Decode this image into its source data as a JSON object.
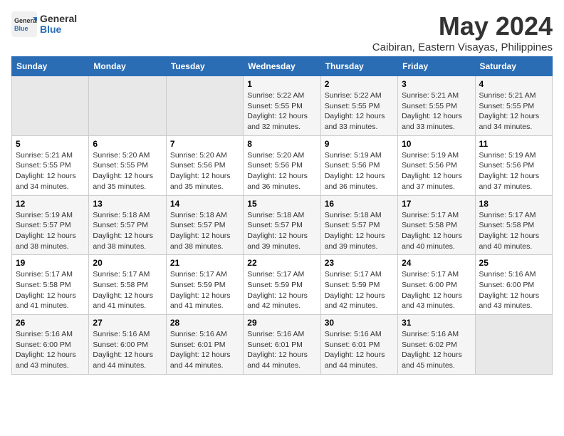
{
  "header": {
    "logo_general": "General",
    "logo_blue": "Blue",
    "month_year": "May 2024",
    "location": "Caibiran, Eastern Visayas, Philippines"
  },
  "weekdays": [
    "Sunday",
    "Monday",
    "Tuesday",
    "Wednesday",
    "Thursday",
    "Friday",
    "Saturday"
  ],
  "weeks": [
    [
      {
        "day": "",
        "sunrise": "",
        "sunset": "",
        "daylight": "",
        "empty": true
      },
      {
        "day": "",
        "sunrise": "",
        "sunset": "",
        "daylight": "",
        "empty": true
      },
      {
        "day": "",
        "sunrise": "",
        "sunset": "",
        "daylight": "",
        "empty": true
      },
      {
        "day": "1",
        "sunrise": "Sunrise: 5:22 AM",
        "sunset": "Sunset: 5:55 PM",
        "daylight": "Daylight: 12 hours and 32 minutes."
      },
      {
        "day": "2",
        "sunrise": "Sunrise: 5:22 AM",
        "sunset": "Sunset: 5:55 PM",
        "daylight": "Daylight: 12 hours and 33 minutes."
      },
      {
        "day": "3",
        "sunrise": "Sunrise: 5:21 AM",
        "sunset": "Sunset: 5:55 PM",
        "daylight": "Daylight: 12 hours and 33 minutes."
      },
      {
        "day": "4",
        "sunrise": "Sunrise: 5:21 AM",
        "sunset": "Sunset: 5:55 PM",
        "daylight": "Daylight: 12 hours and 34 minutes."
      }
    ],
    [
      {
        "day": "5",
        "sunrise": "Sunrise: 5:21 AM",
        "sunset": "Sunset: 5:55 PM",
        "daylight": "Daylight: 12 hours and 34 minutes."
      },
      {
        "day": "6",
        "sunrise": "Sunrise: 5:20 AM",
        "sunset": "Sunset: 5:55 PM",
        "daylight": "Daylight: 12 hours and 35 minutes."
      },
      {
        "day": "7",
        "sunrise": "Sunrise: 5:20 AM",
        "sunset": "Sunset: 5:56 PM",
        "daylight": "Daylight: 12 hours and 35 minutes."
      },
      {
        "day": "8",
        "sunrise": "Sunrise: 5:20 AM",
        "sunset": "Sunset: 5:56 PM",
        "daylight": "Daylight: 12 hours and 36 minutes."
      },
      {
        "day": "9",
        "sunrise": "Sunrise: 5:19 AM",
        "sunset": "Sunset: 5:56 PM",
        "daylight": "Daylight: 12 hours and 36 minutes."
      },
      {
        "day": "10",
        "sunrise": "Sunrise: 5:19 AM",
        "sunset": "Sunset: 5:56 PM",
        "daylight": "Daylight: 12 hours and 37 minutes."
      },
      {
        "day": "11",
        "sunrise": "Sunrise: 5:19 AM",
        "sunset": "Sunset: 5:56 PM",
        "daylight": "Daylight: 12 hours and 37 minutes."
      }
    ],
    [
      {
        "day": "12",
        "sunrise": "Sunrise: 5:19 AM",
        "sunset": "Sunset: 5:57 PM",
        "daylight": "Daylight: 12 hours and 38 minutes."
      },
      {
        "day": "13",
        "sunrise": "Sunrise: 5:18 AM",
        "sunset": "Sunset: 5:57 PM",
        "daylight": "Daylight: 12 hours and 38 minutes."
      },
      {
        "day": "14",
        "sunrise": "Sunrise: 5:18 AM",
        "sunset": "Sunset: 5:57 PM",
        "daylight": "Daylight: 12 hours and 38 minutes."
      },
      {
        "day": "15",
        "sunrise": "Sunrise: 5:18 AM",
        "sunset": "Sunset: 5:57 PM",
        "daylight": "Daylight: 12 hours and 39 minutes."
      },
      {
        "day": "16",
        "sunrise": "Sunrise: 5:18 AM",
        "sunset": "Sunset: 5:57 PM",
        "daylight": "Daylight: 12 hours and 39 minutes."
      },
      {
        "day": "17",
        "sunrise": "Sunrise: 5:17 AM",
        "sunset": "Sunset: 5:58 PM",
        "daylight": "Daylight: 12 hours and 40 minutes."
      },
      {
        "day": "18",
        "sunrise": "Sunrise: 5:17 AM",
        "sunset": "Sunset: 5:58 PM",
        "daylight": "Daylight: 12 hours and 40 minutes."
      }
    ],
    [
      {
        "day": "19",
        "sunrise": "Sunrise: 5:17 AM",
        "sunset": "Sunset: 5:58 PM",
        "daylight": "Daylight: 12 hours and 41 minutes."
      },
      {
        "day": "20",
        "sunrise": "Sunrise: 5:17 AM",
        "sunset": "Sunset: 5:58 PM",
        "daylight": "Daylight: 12 hours and 41 minutes."
      },
      {
        "day": "21",
        "sunrise": "Sunrise: 5:17 AM",
        "sunset": "Sunset: 5:59 PM",
        "daylight": "Daylight: 12 hours and 41 minutes."
      },
      {
        "day": "22",
        "sunrise": "Sunrise: 5:17 AM",
        "sunset": "Sunset: 5:59 PM",
        "daylight": "Daylight: 12 hours and 42 minutes."
      },
      {
        "day": "23",
        "sunrise": "Sunrise: 5:17 AM",
        "sunset": "Sunset: 5:59 PM",
        "daylight": "Daylight: 12 hours and 42 minutes."
      },
      {
        "day": "24",
        "sunrise": "Sunrise: 5:17 AM",
        "sunset": "Sunset: 6:00 PM",
        "daylight": "Daylight: 12 hours and 43 minutes."
      },
      {
        "day": "25",
        "sunrise": "Sunrise: 5:16 AM",
        "sunset": "Sunset: 6:00 PM",
        "daylight": "Daylight: 12 hours and 43 minutes."
      }
    ],
    [
      {
        "day": "26",
        "sunrise": "Sunrise: 5:16 AM",
        "sunset": "Sunset: 6:00 PM",
        "daylight": "Daylight: 12 hours and 43 minutes."
      },
      {
        "day": "27",
        "sunrise": "Sunrise: 5:16 AM",
        "sunset": "Sunset: 6:00 PM",
        "daylight": "Daylight: 12 hours and 44 minutes."
      },
      {
        "day": "28",
        "sunrise": "Sunrise: 5:16 AM",
        "sunset": "Sunset: 6:01 PM",
        "daylight": "Daylight: 12 hours and 44 minutes."
      },
      {
        "day": "29",
        "sunrise": "Sunrise: 5:16 AM",
        "sunset": "Sunset: 6:01 PM",
        "daylight": "Daylight: 12 hours and 44 minutes."
      },
      {
        "day": "30",
        "sunrise": "Sunrise: 5:16 AM",
        "sunset": "Sunset: 6:01 PM",
        "daylight": "Daylight: 12 hours and 44 minutes."
      },
      {
        "day": "31",
        "sunrise": "Sunrise: 5:16 AM",
        "sunset": "Sunset: 6:02 PM",
        "daylight": "Daylight: 12 hours and 45 minutes."
      },
      {
        "day": "",
        "sunrise": "",
        "sunset": "",
        "daylight": "",
        "empty": true
      }
    ]
  ]
}
